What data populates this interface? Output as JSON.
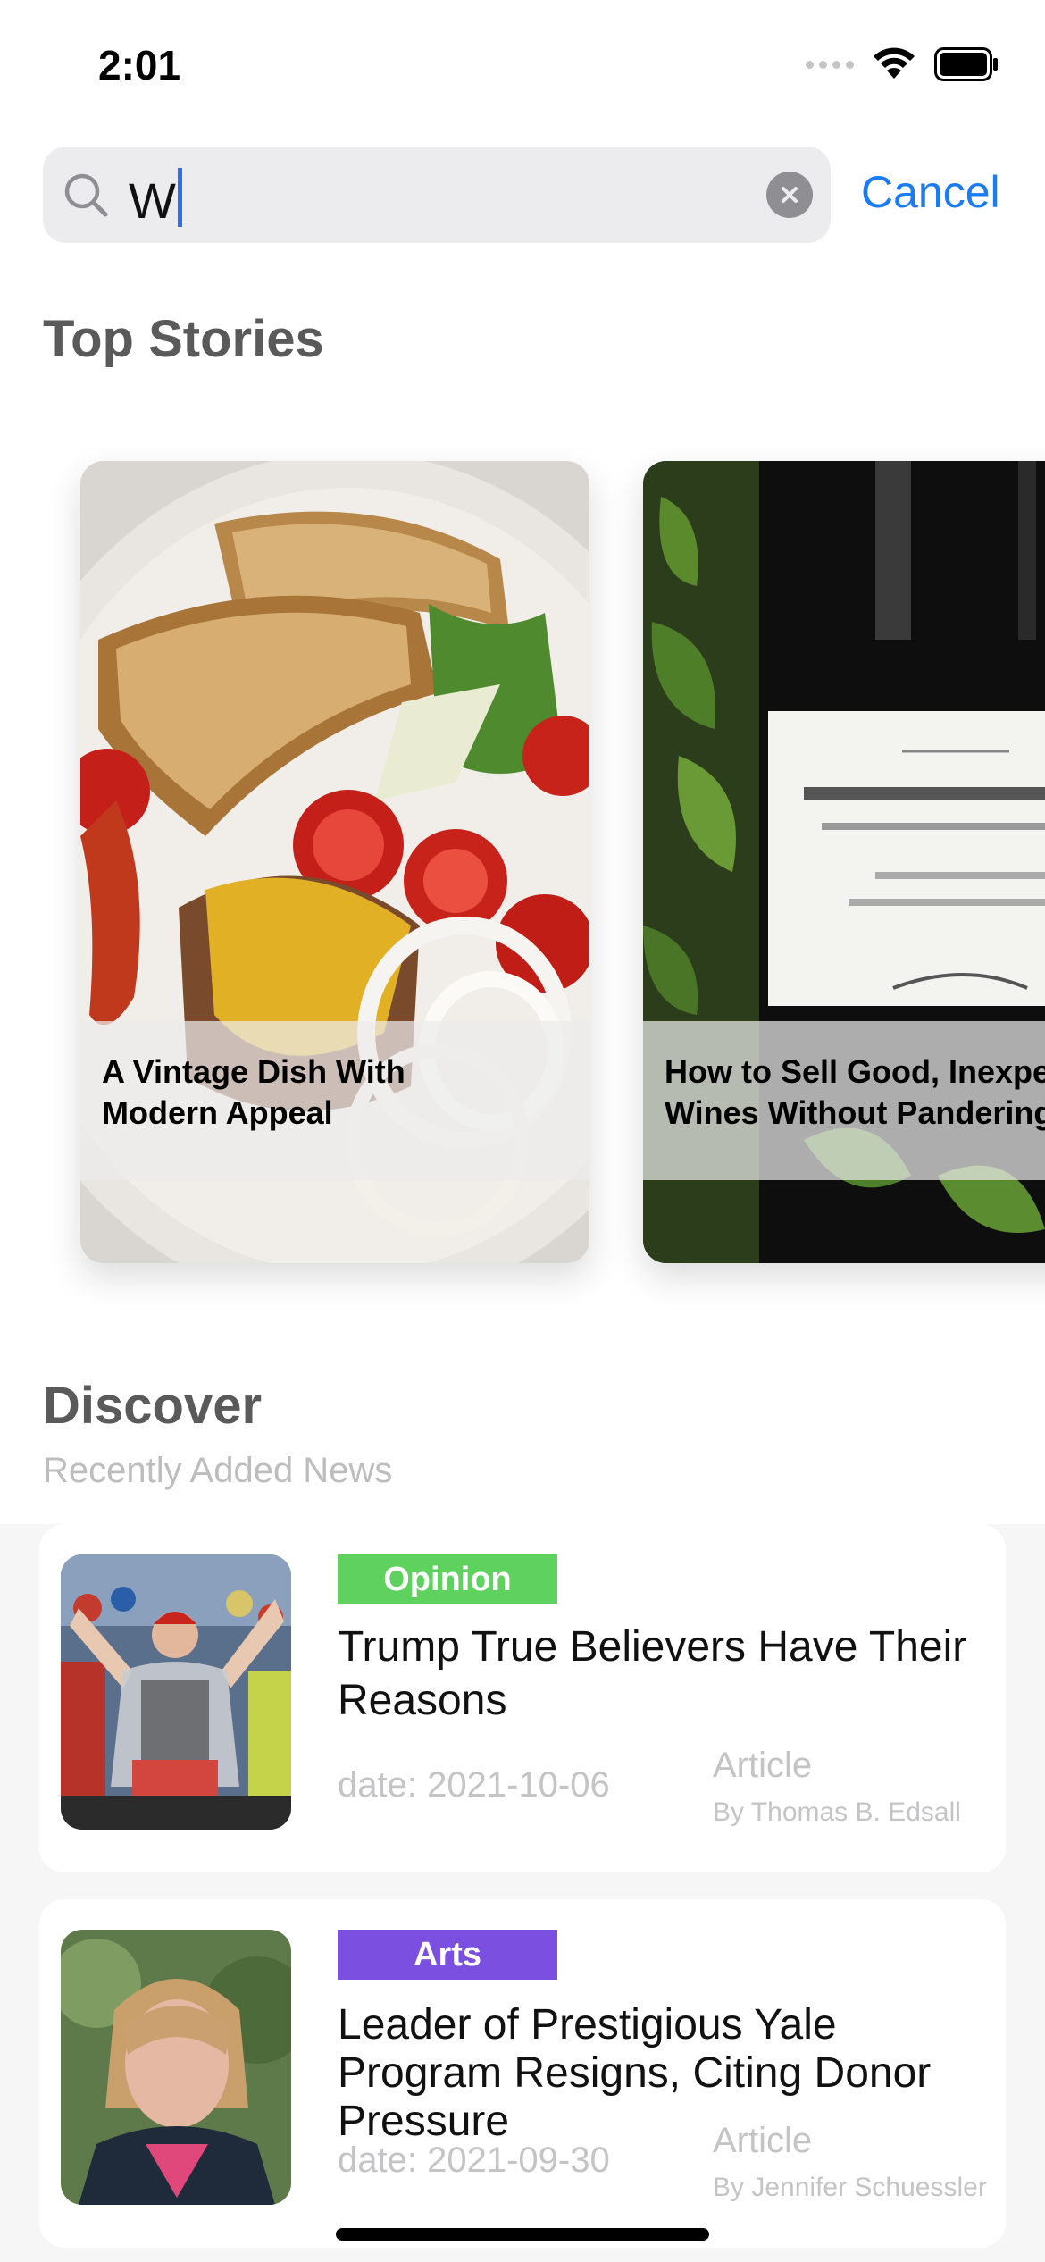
{
  "status_bar": {
    "time": "2:01"
  },
  "search": {
    "value": "W",
    "cancel_label": "Cancel"
  },
  "top_stories": {
    "title": "Top Stories",
    "cards": [
      {
        "caption_line1": "A Vintage Dish With",
        "caption_line2": "Modern Appeal"
      },
      {
        "caption_line1": "How to Sell Good, Inexpe",
        "caption_line2": "Wines Without Pandering"
      }
    ]
  },
  "discover": {
    "title": "Discover",
    "subtitle": "Recently Added News",
    "items": [
      {
        "tag": "Opinion",
        "tag_color": "#5fd15f",
        "headline": "Trump True Believers Have Their Reasons",
        "date": "date: 2021-10-06",
        "kind": "Article",
        "author": "By Thomas B. Edsall"
      },
      {
        "tag": "Arts",
        "tag_color": "#7b4fe0",
        "headline": "Leader of Prestigious Yale Program Resigns, Citing Donor Pressure",
        "date": "date: 2021-09-30",
        "kind": "Article",
        "author": "By Jennifer Schuessler"
      }
    ]
  },
  "colors": {
    "accent": "#1a7cf5",
    "title_gray": "#5a5a5a",
    "muted": "#c4c4c6"
  }
}
